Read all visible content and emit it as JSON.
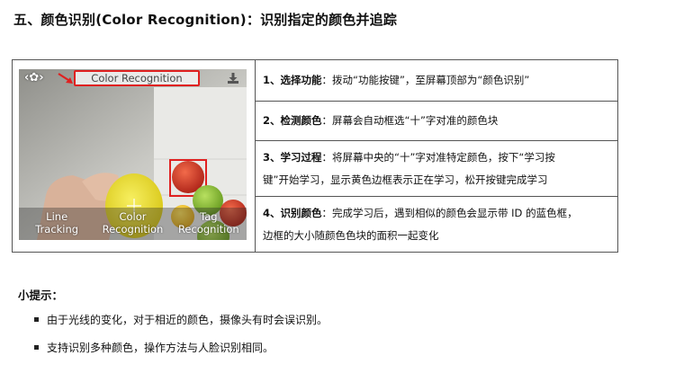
{
  "heading": "五、颜色识别(Color Recognition)：识别指定的颜色并追踪",
  "screenshot": {
    "nav_glyphs": "‹✿›",
    "function_label": "Color Recognition",
    "modes": [
      {
        "line1": "Line",
        "line2": "Tracking"
      },
      {
        "line1": "Color",
        "line2": "Recognition"
      },
      {
        "line1": "Tag",
        "line2": "Recognition"
      }
    ],
    "highlight_color": "#e02020",
    "icons": [
      "settings-icon",
      "download-icon"
    ]
  },
  "steps": [
    {
      "label": "1、选择功能",
      "text": "：拨动“功能按键”，至屏幕顶部为“颜色识别”"
    },
    {
      "label": "2、检测颜色",
      "text": "：屏幕会自动框选“十”字对准的颜色块"
    },
    {
      "label": "3、学习过程",
      "text": "：将屏幕中央的“十”字对准特定颜色，按下“学习按",
      "text2": "键”开始学习，显示黄色边框表示正在学习，松开按键完成学习"
    },
    {
      "label": "4、识别颜色",
      "text": "：完成学习后，遇到相似的颜色会显示带 ID 的蓝色框，",
      "text2": "边框的大小随颜色色块的面积一起变化"
    }
  ],
  "tips": {
    "title": "小提示：",
    "items": [
      "由于光线的变化，对于相近的颜色，摄像头有时会误识别。",
      "支持识别多种颜色，操作方法与人脸识别相同。"
    ]
  }
}
